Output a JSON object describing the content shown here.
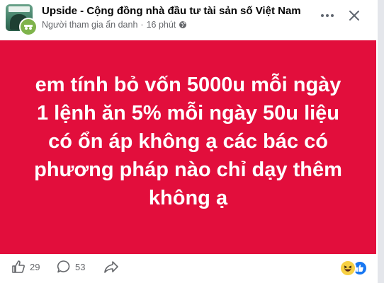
{
  "header": {
    "group_name": "Upside - Cộng đồng nhà đầu tư tài sản số Việt Nam",
    "author": "Người tham gia ẩn danh",
    "separator": "·",
    "time": "16 phút",
    "more_icon": "ellipsis-icon",
    "close_icon": "close-icon",
    "privacy_icon": "globe-icon"
  },
  "post": {
    "text_lines": [
      "em tính bỏ vốn 5000u mỗi ngày",
      "1 lệnh ăn 5% mỗi ngày 50u liệu",
      "có ổn áp không ạ các bác có",
      "phương pháp nào chỉ dạy thêm",
      "không ạ"
    ],
    "background_color": "#e20e3c",
    "text_color": "#ffffff"
  },
  "actions": {
    "like_count": "29",
    "comment_count": "53",
    "reactions": [
      "haha",
      "like"
    ]
  }
}
